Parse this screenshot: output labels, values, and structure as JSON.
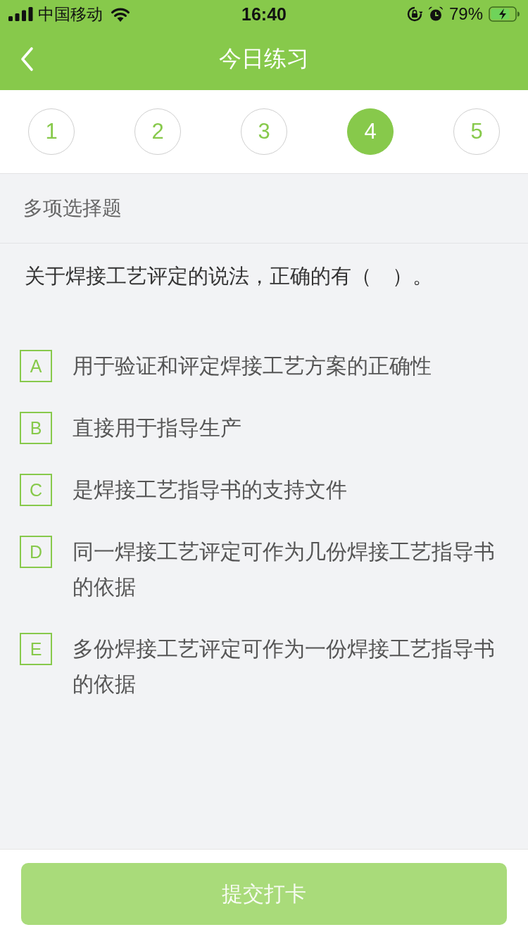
{
  "status_bar": {
    "carrier": "中国移动",
    "time": "16:40",
    "battery": "79%"
  },
  "nav": {
    "title": "今日练习"
  },
  "question_numbers": [
    {
      "label": "1",
      "selected": false
    },
    {
      "label": "2",
      "selected": false
    },
    {
      "label": "3",
      "selected": false
    },
    {
      "label": "4",
      "selected": true
    },
    {
      "label": "5",
      "selected": false
    }
  ],
  "question_type": "多项选择题",
  "question": "关于焊接工艺评定的说法，正确的有（　）。",
  "options": [
    {
      "letter": "A",
      "text": "用于验证和评定焊接工艺方案的正确性",
      "selected": false
    },
    {
      "letter": "B",
      "text": "直接用于指导生产",
      "selected": false
    },
    {
      "letter": "C",
      "text": "是焊接工艺指导书的支持文件",
      "selected": false
    },
    {
      "letter": "D",
      "text": "同一焊接工艺评定可作为几份焊接工艺指导书的依据",
      "selected": false
    },
    {
      "letter": "E",
      "text": "多份焊接工艺评定可作为一份焊接工艺指导书的依据",
      "selected": false
    }
  ],
  "submit_button": {
    "label": "提交打卡",
    "disabled": true
  }
}
